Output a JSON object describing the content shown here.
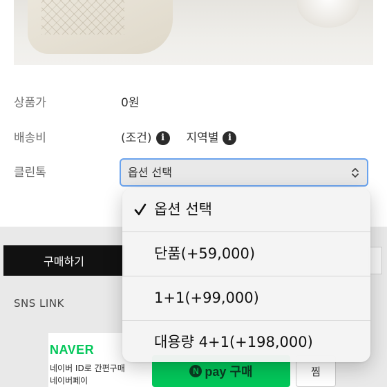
{
  "product": {
    "price_label": "상품가",
    "price_value": "0원",
    "shipping_label": "배송비",
    "shipping_condition": "(조건)",
    "shipping_region": "지역별",
    "info_icon_glyph": "i",
    "option_label": "클린톡"
  },
  "select": {
    "current_value": "옵션 선택"
  },
  "dropdown": {
    "options": [
      {
        "label": "옵션 선택",
        "selected": true
      },
      {
        "label": "단품(+59,000)",
        "selected": false
      },
      {
        "label": "1+1(+99,000)",
        "selected": false
      },
      {
        "label": "대용량 4+1(+198,000)",
        "selected": false
      }
    ]
  },
  "actions": {
    "buy_label": "구매하기",
    "sns_label": "SNS LINK"
  },
  "naver": {
    "logo": "NAVER",
    "line1": "네이버 ID로 간편구매",
    "line2": "네이버페이",
    "npay_n": "N",
    "npay_label": "pay 구매",
    "zzim_label": "찜"
  },
  "colors": {
    "select_border": "#6aa3ee",
    "naver_green": "#03c75a",
    "buy_button_bg": "#111111"
  },
  "icons": [
    "info-circle-icon",
    "chevron-updown-icon",
    "checkmark-icon"
  ]
}
